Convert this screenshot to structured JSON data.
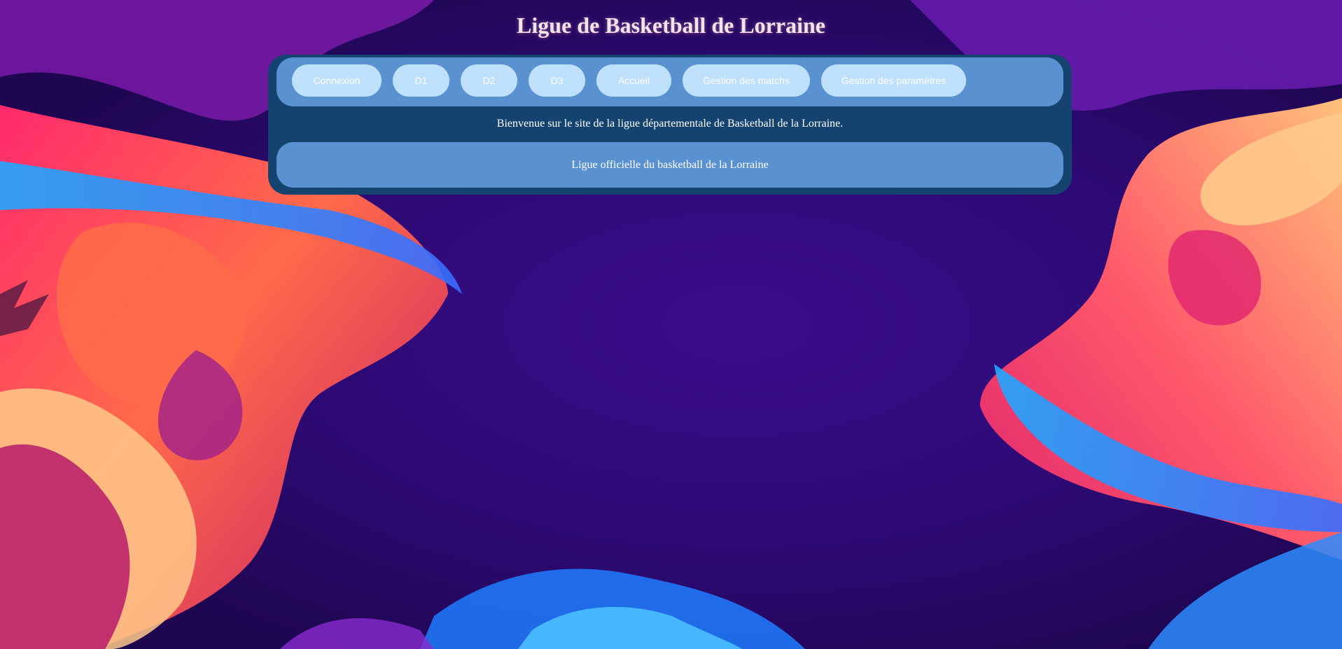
{
  "header": {
    "title": "Ligue de Basketball de Lorraine"
  },
  "nav": {
    "items": [
      {
        "label": "Connexion"
      },
      {
        "label": "D1"
      },
      {
        "label": "D2"
      },
      {
        "label": "D3"
      },
      {
        "label": "Accueil"
      },
      {
        "label": "Gestion des matchs"
      },
      {
        "label": "Gestion des paramètres"
      }
    ]
  },
  "main": {
    "welcome": "Bienvenue sur le site de la ligue départementale de Basketball de la Lorraine."
  },
  "footer": {
    "text": "Ligue officielle du basketball de la Lorraine"
  },
  "colors": {
    "panel": "#15436f",
    "nav_bar": "#5a91d1",
    "button": "#bfe0fb",
    "title": "#f3e3ea",
    "background": "#2a0a6e"
  }
}
